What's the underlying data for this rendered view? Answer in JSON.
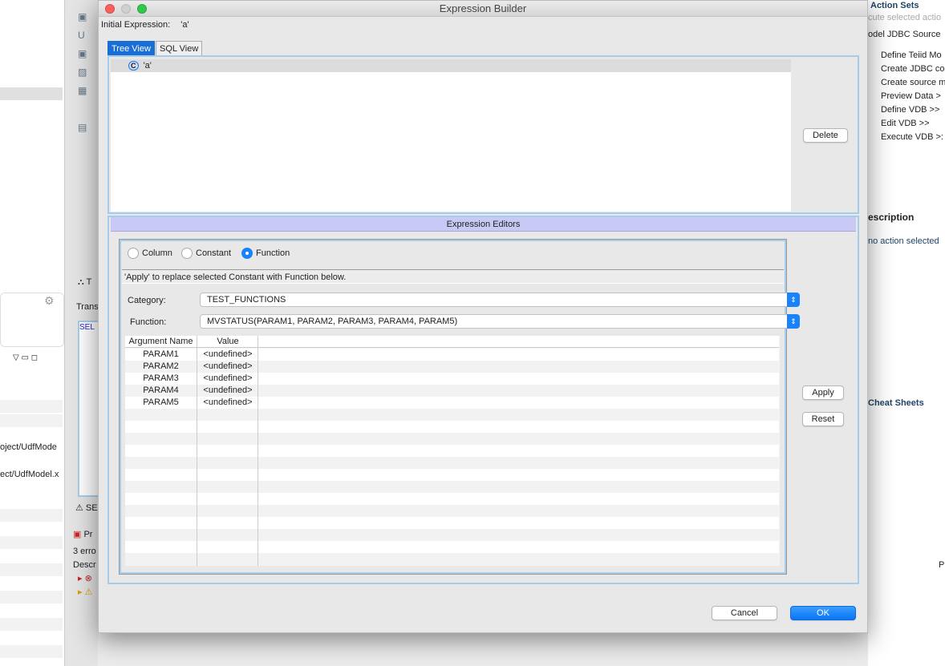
{
  "background": {
    "left_paths": [
      "oject/UdfMode",
      "ect/UdfModel.x"
    ],
    "middle": {
      "tab_trans": "Trans",
      "sql_snip": "SEL",
      "warn_snip": "SEL",
      "problems_tab": "Pr",
      "errors": "3 erro",
      "desc_col": "Descr",
      "t_label": "T"
    },
    "right": {
      "header": "Action Sets",
      "execute_hint": "cute selected actio",
      "combo": "odel JDBC Source",
      "actions": [
        "Define Teiid Mo",
        "Create JDBC co",
        "Create source m",
        "Preview Data >",
        "Define VDB >>",
        "Edit VDB >>",
        "Execute VDB >:"
      ],
      "description_title": "escription",
      "description_text": "no action selected",
      "cheat_sheets": "Cheat Sheets",
      "p_col": "P"
    }
  },
  "dialog": {
    "title": "Expression Builder",
    "initial_label": "Initial Expression:",
    "initial_value": "'a'",
    "tabs": [
      "Tree View",
      "SQL View"
    ],
    "tree": {
      "node": "'a'",
      "node_icon": "constant-icon"
    },
    "delete_label": "Delete",
    "editors_title": "Expression Editors",
    "radios": {
      "options": [
        "Column",
        "Constant",
        "Function"
      ],
      "selected": "Function"
    },
    "message": "'Apply' to replace selected Constant with Function below.",
    "category_label": "Category:",
    "category_value": "TEST_FUNCTIONS",
    "function_label": "Function:",
    "function_value": "MVSTATUS(PARAM1, PARAM2, PARAM3, PARAM4, PARAM5)",
    "table": {
      "headers": [
        "Argument Name",
        "Value"
      ],
      "rows": [
        [
          "PARAM1",
          "<undefined>"
        ],
        [
          "PARAM2",
          "<undefined>"
        ],
        [
          "PARAM3",
          "<undefined>"
        ],
        [
          "PARAM4",
          "<undefined>"
        ],
        [
          "PARAM5",
          "<undefined>"
        ]
      ]
    },
    "apply_label": "Apply",
    "reset_label": "Reset",
    "cancel_label": "Cancel",
    "ok_label": "OK",
    "accent": "#1a82fb"
  }
}
